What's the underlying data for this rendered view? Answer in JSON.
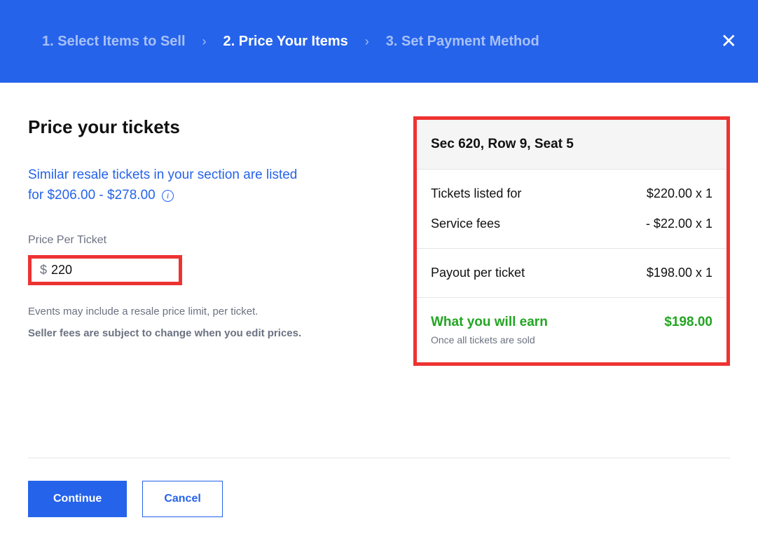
{
  "header": {
    "steps": [
      {
        "label": "1. Select Items to Sell",
        "active": false
      },
      {
        "label": "2. Price Your Items",
        "active": true
      },
      {
        "label": "3. Set Payment Method",
        "active": false
      }
    ]
  },
  "main": {
    "title": "Price your tickets",
    "similar_line1": "Similar resale tickets in your section are listed",
    "similar_line2": "for $206.00 - $278.00",
    "field_label": "Price Per Ticket",
    "currency_symbol": "$",
    "price_value": "220",
    "note_text": "Events may include a resale price limit, per ticket.",
    "note_bold": "Seller fees are subject to change when you edit prices."
  },
  "summary": {
    "seat_label": "Sec 620, Row 9, Seat 5",
    "rows": [
      {
        "label": "Tickets listed for",
        "value": "$220.00 x 1"
      },
      {
        "label": "Service fees",
        "value": "- $22.00 x 1"
      }
    ],
    "payout": {
      "label": "Payout per ticket",
      "value": "$198.00 x 1"
    },
    "earn": {
      "label": "What you will earn",
      "amount": "$198.00",
      "sub": "Once all tickets are sold"
    }
  },
  "buttons": {
    "continue": "Continue",
    "cancel": "Cancel"
  }
}
